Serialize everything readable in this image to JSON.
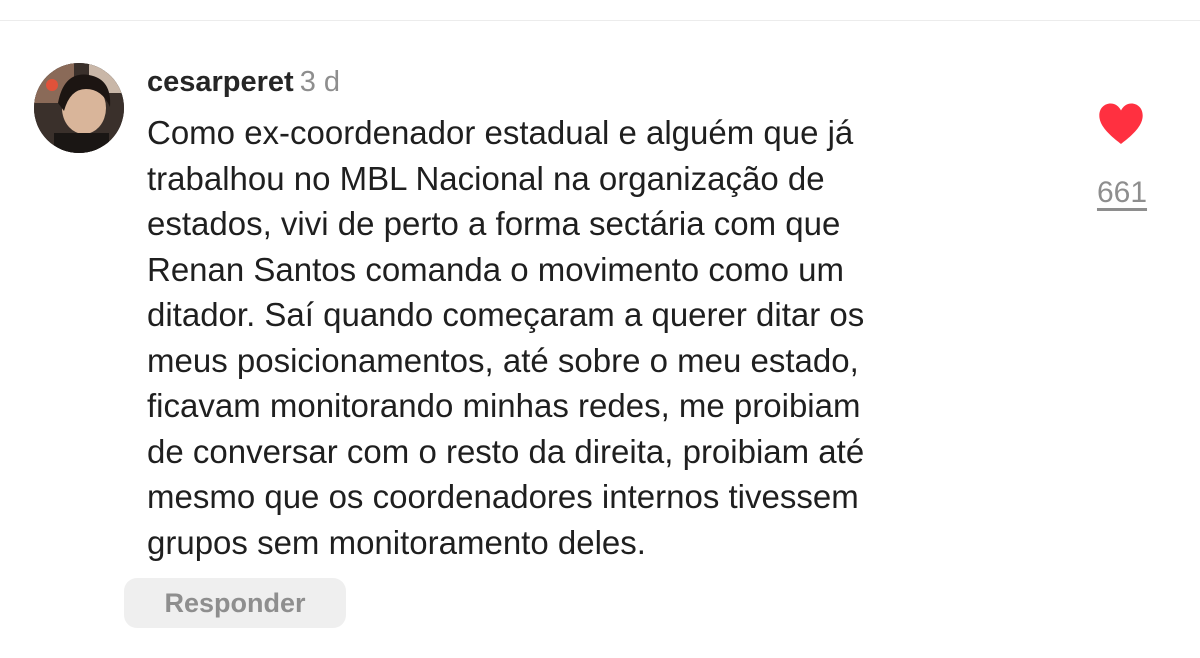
{
  "comment": {
    "username": "cesarperet",
    "timestamp": "3 d",
    "text_lines": [
      "Como ex-coordenador estadual e alguém que já",
      "trabalhou no MBL Nacional na organização de",
      "estados, vivi de perto a forma sectária com que",
      "Renan Santos comanda o movimento como um",
      "ditador. Saí quando começaram a querer ditar os",
      "meus posicionamentos, até sobre o meu estado,",
      "ficavam monitorando minhas redes, me proibiam",
      "de conversar com o resto da direita, proibiam até",
      "mesmo que os coordenadores internos tivessem",
      "grupos sem monitoramento deles."
    ],
    "reply_label": "Responder"
  },
  "likes": {
    "icon": "heart-icon",
    "count": "661",
    "color": "#ff3040"
  }
}
